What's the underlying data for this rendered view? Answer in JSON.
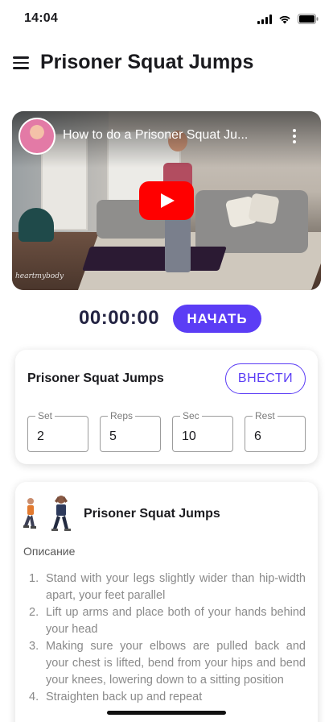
{
  "status_bar": {
    "time": "14:04",
    "icons": [
      "cellular-signal-icon",
      "wifi-icon",
      "battery-icon"
    ]
  },
  "header": {
    "menu_icon": "hamburger-menu-icon",
    "title": "Prisoner Squat Jumps"
  },
  "video": {
    "title": "How to do a Prisoner Squat Ju...",
    "watermark": "heartmybody",
    "play_icon": "youtube-play-icon",
    "more_icon": "more-vertical-icon"
  },
  "timer": {
    "value": "00:00:00",
    "start_label": "НАЧАТЬ"
  },
  "log_card": {
    "exercise_name": "Prisoner Squat Jumps",
    "enter_label": "ВНЕСТИ",
    "fields": [
      {
        "label": "Set",
        "value": "2"
      },
      {
        "label": "Reps",
        "value": "5"
      },
      {
        "label": "Sec",
        "value": "10"
      },
      {
        "label": "Rest",
        "value": "6"
      }
    ]
  },
  "description_card": {
    "title": "Prisoner Squat Jumps",
    "label": "Описание",
    "steps": [
      {
        "num": "1.",
        "text": "Stand with your legs slightly wider than hip-width apart, your feet parallel"
      },
      {
        "num": "2.",
        "text": "Lift up arms and place both of your hands behind your head"
      },
      {
        "num": "3.",
        "text": "Making sure your elbows are pulled back and your chest is lifted, bend from your hips and bend your knees, lowering down to a sitting position"
      },
      {
        "num": "4.",
        "text": "Straighten back up and repeat"
      }
    ]
  },
  "colors": {
    "accent": "#5b3df5",
    "title_text": "#1b1b1f",
    "timer_text": "#232342",
    "youtube_red": "#ff0000"
  }
}
